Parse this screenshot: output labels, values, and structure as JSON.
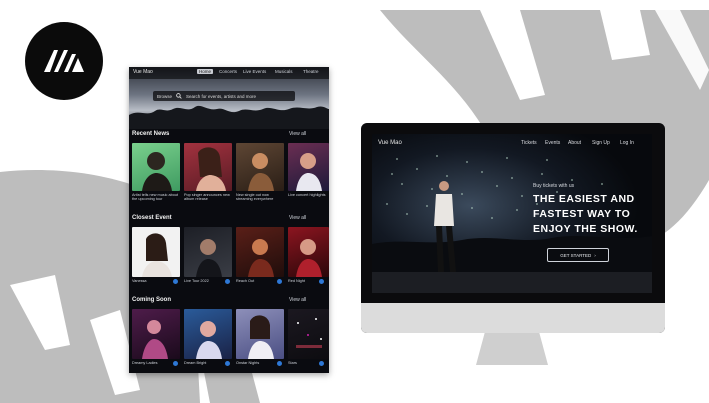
{
  "brand": {
    "logo_text": "W",
    "name": "Vue Mao",
    "colors": {
      "dark": "#0b0b0b",
      "shape_gray": "#b9b9b9",
      "accent_blue": "#2e78d6"
    }
  },
  "tablet": {
    "nav": {
      "brand": "Vue Mao",
      "links": [
        "Home",
        "Concerts",
        "Live Events",
        "Musicals",
        "Theatre"
      ],
      "active_index": 0
    },
    "search": {
      "left": "Browse",
      "placeholder": "Search for events, artists and more"
    },
    "sections": [
      {
        "title": "Recent News",
        "view_all": "View all",
        "items": [
          {
            "caption": "Artist tells new music\nabout the upcoming tour"
          },
          {
            "caption": "Pop singer announces\nnew album release"
          },
          {
            "caption": "New single out now\nstreaming everywhere"
          },
          {
            "caption": "Live concert\nhighlights"
          }
        ]
      },
      {
        "title": "Closest Event",
        "view_all": "View all",
        "items": [
          {
            "caption": "Vanessa"
          },
          {
            "caption": "Live Tour 2022"
          },
          {
            "caption": "Reach Out"
          },
          {
            "caption": "Red Night"
          }
        ]
      },
      {
        "title": "Coming Soon",
        "view_all": "View all",
        "items": [
          {
            "caption": "Dreamy Ladies"
          },
          {
            "caption": "Dream Bright"
          },
          {
            "caption": "Onstar Nights"
          },
          {
            "caption": "Stars"
          }
        ]
      }
    ]
  },
  "monitor": {
    "nav": {
      "brand": "Vue Mao",
      "links": [
        "Tickets",
        "Events",
        "About",
        "Sign Up",
        "Log In"
      ]
    },
    "small_text": "Buy tickets with us",
    "headline": [
      "THE EASIEST AND",
      "FASTEST WAY TO",
      "ENJOY THE SHOW."
    ],
    "button_label": "GET STARTED"
  },
  "icons": {
    "logo": "w-logo-icon",
    "search": "search-icon",
    "arrow": "arrow-right-icon",
    "favorite": "heart-badge-icon"
  }
}
